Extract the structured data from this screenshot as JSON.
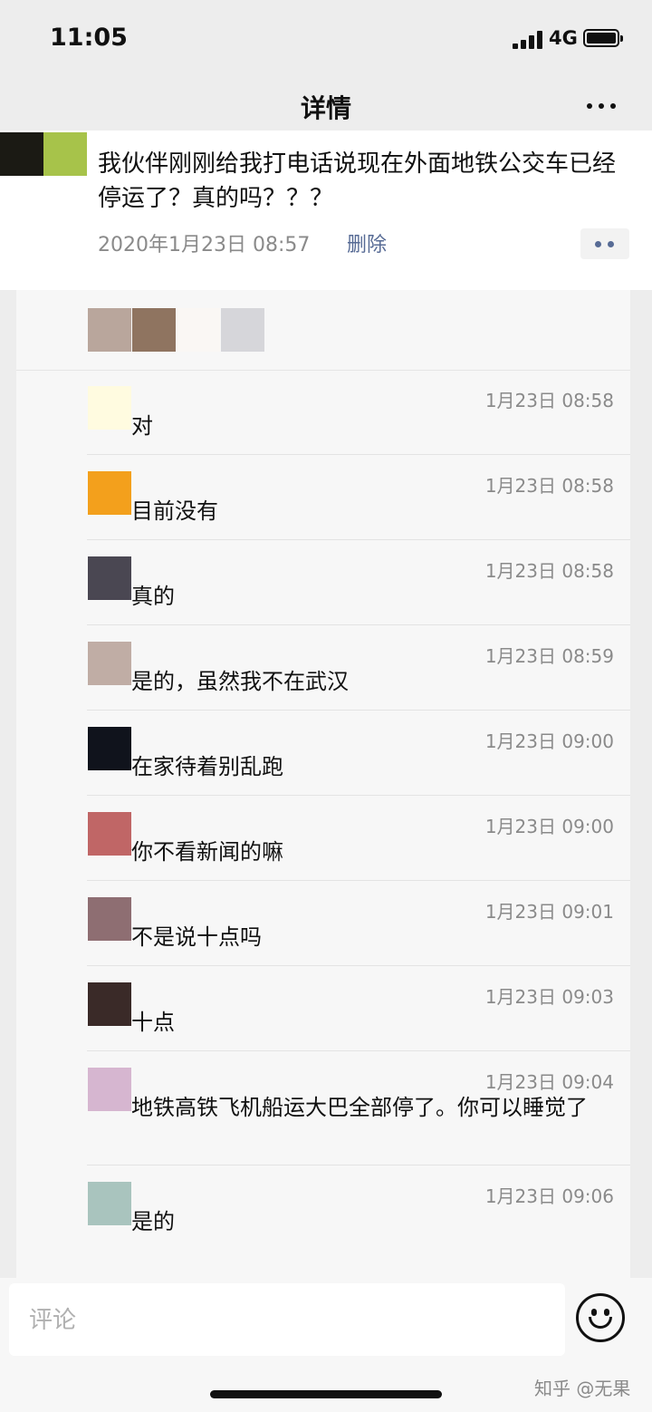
{
  "status_bar": {
    "time": "11:05",
    "network": "4G"
  },
  "nav": {
    "title": "详情",
    "more_icon": "more-dots-icon"
  },
  "post": {
    "text": "我伙伴刚刚给我打电话说现在外面地铁公交车已经停运了？真的吗？？？",
    "timestamp": "2020年1月23日 08:57",
    "delete_label": "删除",
    "avatar_colors": [
      "#1b1a14",
      "#a7c34a"
    ]
  },
  "likes": {
    "avatar_colors": [
      "#b9a69c",
      "#8f7460",
      "#faf7f4",
      "#d6d6da"
    ]
  },
  "comments": [
    {
      "time": "1月23日 08:58",
      "text": "对",
      "avatar_color": "#fffbe0"
    },
    {
      "time": "1月23日 08:58",
      "text": "目前没有",
      "avatar_color": "#f3a01c"
    },
    {
      "time": "1月23日 08:58",
      "text": "真的",
      "avatar_color": "#4a4752"
    },
    {
      "time": "1月23日 08:59",
      "text": "是的，虽然我不在武汉",
      "avatar_color": "#c0ada5"
    },
    {
      "time": "1月23日 09:00",
      "text": "在家待着别乱跑",
      "avatar_color": "#10131c"
    },
    {
      "time": "1月23日 09:00",
      "text": "你不看新闻的嘛",
      "avatar_color": "#c06666"
    },
    {
      "time": "1月23日 09:01",
      "text": "不是说十点吗",
      "avatar_color": "#8e6e72"
    },
    {
      "time": "1月23日 09:03",
      "text": "十点",
      "avatar_color": "#3a2a28"
    },
    {
      "time": "1月23日 09:04",
      "text": "地铁高铁飞机船运大巴全部停了。你可以睡觉了",
      "avatar_color": "#d6b6d0"
    },
    {
      "time": "1月23日 09:06",
      "text": "是的",
      "avatar_color": "#a9c4be"
    }
  ],
  "input": {
    "placeholder": "评论",
    "emoji_icon": "emoji-smile-icon"
  },
  "watermark": "知乎 @无果"
}
